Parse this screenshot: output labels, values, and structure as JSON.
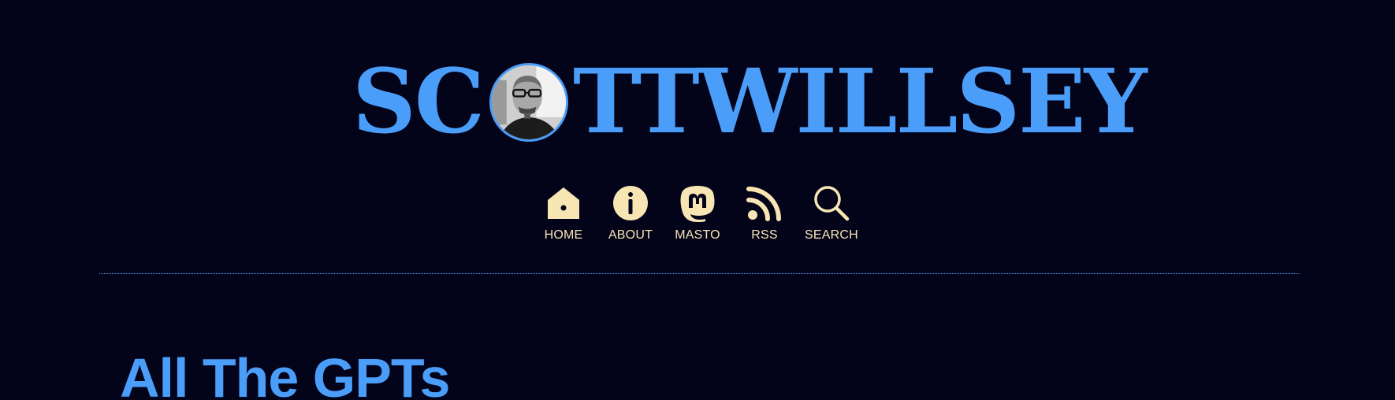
{
  "site": {
    "logo_prefix": "SC",
    "logo_suffix": "TTWILLSEY",
    "accent_color": "#4a9df8",
    "background_color": "#03031a",
    "nav_color": "#f7e6b3"
  },
  "nav": {
    "items": [
      {
        "label": "HOME",
        "icon": "home-icon"
      },
      {
        "label": "ABOUT",
        "icon": "info-icon"
      },
      {
        "label": "MASTO",
        "icon": "mastodon-icon"
      },
      {
        "label": "RSS",
        "icon": "rss-icon"
      },
      {
        "label": "SEARCH",
        "icon": "search-icon"
      }
    ]
  },
  "post": {
    "title": "All The GPTs"
  }
}
